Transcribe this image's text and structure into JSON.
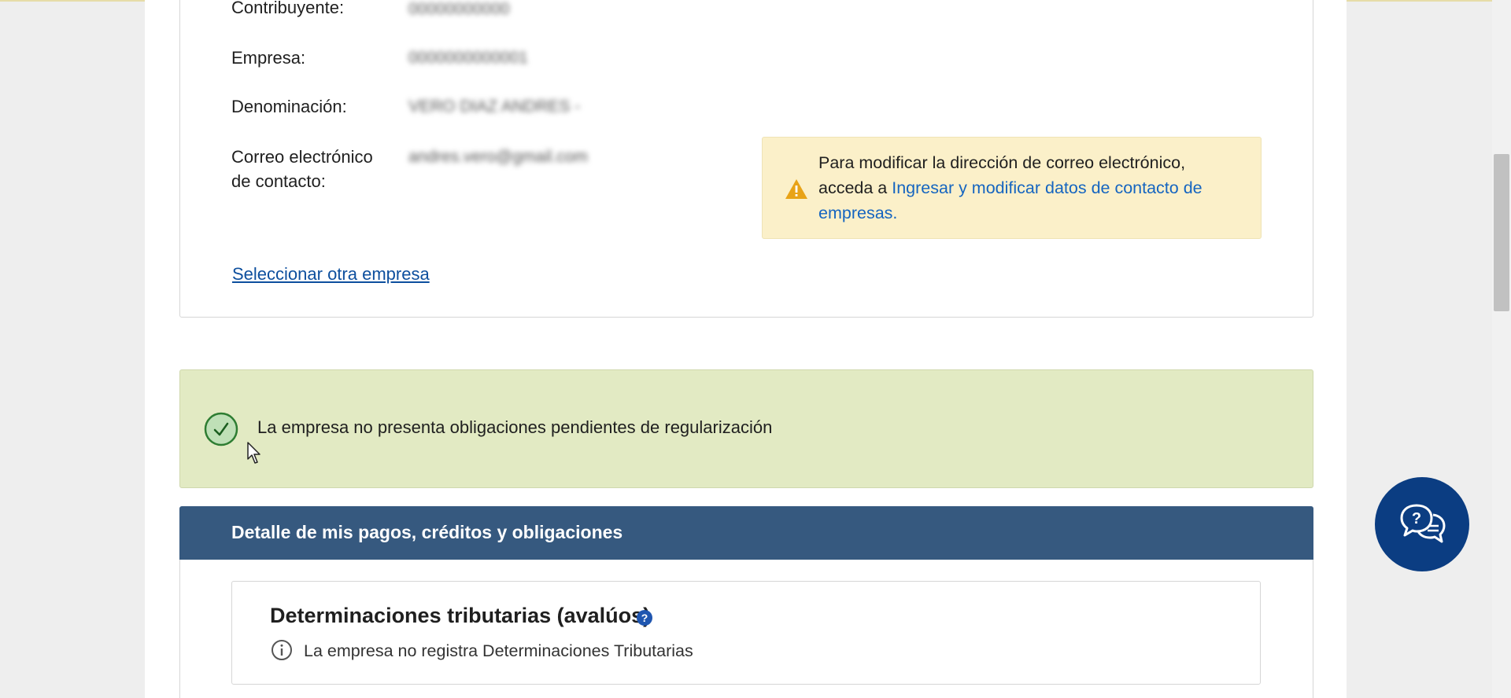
{
  "company": {
    "fields": [
      {
        "label": "Contribuyente:",
        "value": "00000000000"
      },
      {
        "label": "Empresa:",
        "value": "0000000000001"
      },
      {
        "label": "Denominación:",
        "value": "VERO DIAZ ANDRES -"
      },
      {
        "label_line1": "Correo electrónico",
        "label_line2": "de contacto:",
        "value": "andres.vero@gmail.com"
      }
    ],
    "select_link": "Seleccionar otra empresa"
  },
  "notice": {
    "text_line1": "Para modificar la dirección de correo electrónico,",
    "text_prefix": "acceda a ",
    "link_text": "Ingresar y modificar datos de contacto de empresas.",
    "icon": "warning-icon",
    "color": "#fbf0c9"
  },
  "status": {
    "message": "La empresa no presenta obligaciones pendientes de regularización",
    "icon": "check-circle-icon",
    "color": "#e2eac3"
  },
  "detail": {
    "header": "Detalle de mis pagos, créditos y obligaciones",
    "header_color": "#36597f",
    "section": {
      "title": "Determinaciones tributarias (avalúos)",
      "help_icon": "question-icon",
      "info_icon": "info-icon",
      "info": "La empresa no registra Determinaciones Tributarias"
    }
  },
  "chat": {
    "icon": "chat-help-icon",
    "color": "#0b3d82"
  }
}
